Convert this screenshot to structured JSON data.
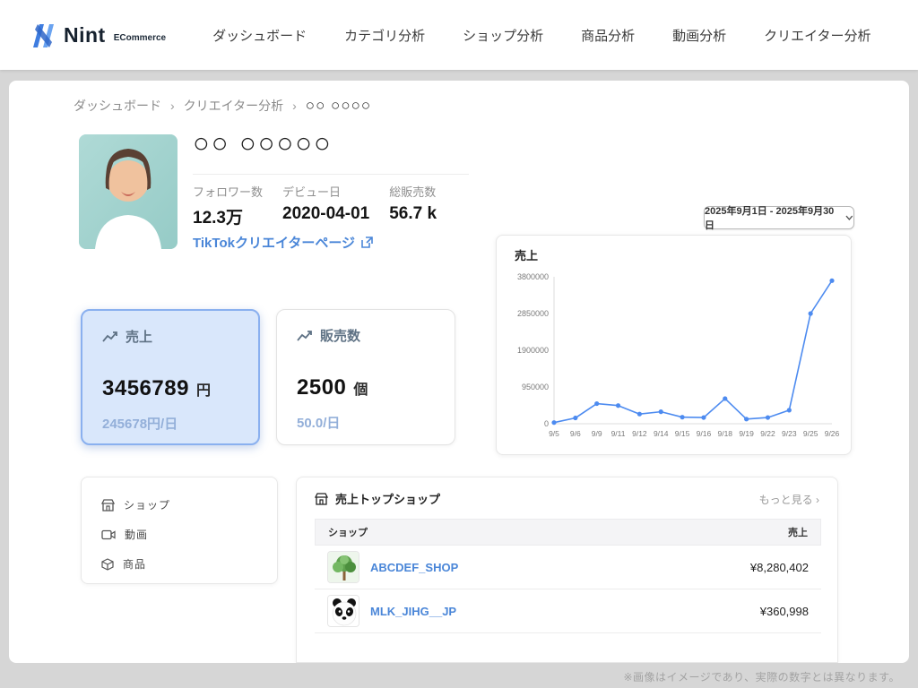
{
  "brand": {
    "name": "Nint",
    "sub": "ECommerce"
  },
  "nav": {
    "items": [
      {
        "label": "ダッシュボード"
      },
      {
        "label": "カテゴリ分析"
      },
      {
        "label": "ショップ分析"
      },
      {
        "label": "商品分析"
      },
      {
        "label": "動画分析"
      },
      {
        "label": "クリエイター分析"
      }
    ]
  },
  "breadcrumb": {
    "items": [
      "ダッシュボード",
      "クリエイター分析",
      "○○ ○○○○"
    ]
  },
  "profile": {
    "name": "○○ ○○○○○",
    "stats": [
      {
        "label": "フォロワー数",
        "value": "12.3万"
      },
      {
        "label": "デビュー日",
        "value": "2020-04-01"
      },
      {
        "label": "総販売数",
        "value": "56.7 k"
      }
    ],
    "link_label": "TikTokクリエイターページ"
  },
  "date_range": {
    "value": "2025年9月1日 - 2025年9月30日"
  },
  "metrics": [
    {
      "label": "売上",
      "value": "3456789",
      "unit": "円",
      "sub": "245678円/日"
    },
    {
      "label": "販売数",
      "value": "2500",
      "unit": "個",
      "sub": "50.0/日"
    }
  ],
  "side_menu": {
    "items": [
      {
        "label": "ショップ"
      },
      {
        "label": "動画"
      },
      {
        "label": "商品"
      }
    ]
  },
  "top_shops": {
    "title": "売上トップショップ",
    "more": "もっと見る ›",
    "columns": [
      "ショップ",
      "売上"
    ],
    "rows": [
      {
        "name": "ABCDEF_SHOP",
        "sales": "¥8,280,402"
      },
      {
        "name": "MLK_JIHG__JP",
        "sales": "¥360,998"
      }
    ]
  },
  "chart_data": {
    "type": "line",
    "title": "売上",
    "x": [
      "9/5",
      "9/6",
      "9/9",
      "9/11",
      "9/12",
      "9/14",
      "9/15",
      "9/16",
      "9/18",
      "9/19",
      "9/22",
      "9/23",
      "9/25",
      "9/26"
    ],
    "series": [
      {
        "name": "売上",
        "values": [
          30000,
          150000,
          520000,
          470000,
          250000,
          310000,
          170000,
          160000,
          650000,
          120000,
          160000,
          350000,
          2850000,
          3700000
        ]
      }
    ],
    "ylim": [
      0,
      3800000
    ],
    "yticks": [
      0,
      950000,
      1900000,
      2850000,
      3800000
    ],
    "line_color": "#4d8bf0",
    "grid": false,
    "legend": "none",
    "xlabel": "",
    "ylabel": ""
  },
  "footer_note": "※画像はイメージであり、実際の数字とは異なります。",
  "colors": {
    "accent": "#4a86d8",
    "selected_bg": "#d9e7fb",
    "selected_border": "#8ab0ef"
  }
}
